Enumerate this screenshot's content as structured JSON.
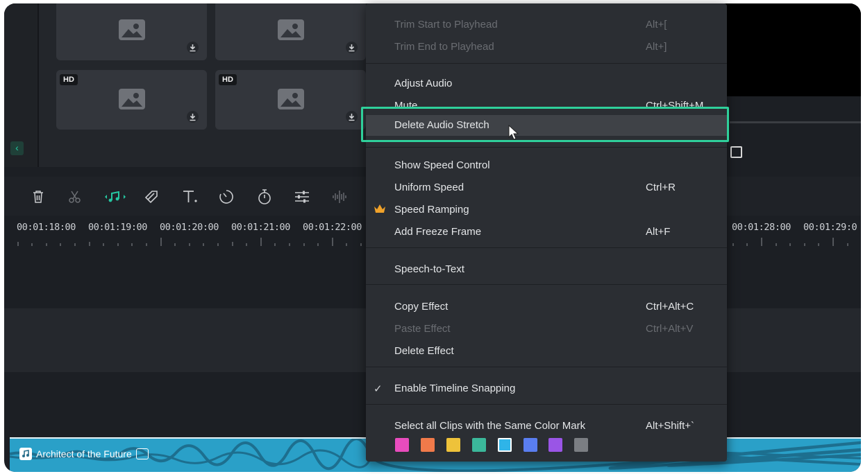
{
  "library": {
    "tiles": [
      {
        "badge": ""
      },
      {
        "badge": ""
      },
      {
        "badge": "HD"
      },
      {
        "badge": "HD"
      }
    ],
    "collapse_glyph": "‹"
  },
  "toolbar": {
    "tools": [
      "delete-icon",
      "scissors-icon",
      "audio-stretch-icon",
      "mask-icon",
      "text-icon",
      "speed-icon",
      "timer-icon",
      "adjust-icon",
      "audio-split-icon"
    ]
  },
  "ruler": {
    "left_labels": [
      "00:01:18:00",
      "00:01:19:00",
      "00:01:20:00",
      "00:01:21:00",
      "00:01:22:00"
    ],
    "right_labels": [
      "00:01:28:00",
      "00:01:29:0"
    ]
  },
  "audio_clip": {
    "title": "Architect of the Future"
  },
  "menu": {
    "items": [
      {
        "label": "Trim Start to Playhead",
        "shortcut": "Alt+[",
        "disabled": true
      },
      {
        "label": "Trim End to Playhead",
        "shortcut": "Alt+]",
        "disabled": true
      },
      {
        "label": "Adjust Audio",
        "shortcut": "",
        "disabled": false
      },
      {
        "label": "Mute",
        "shortcut": "Ctrl+Shift+M",
        "disabled": false
      },
      {
        "label": "Delete Audio Stretch",
        "shortcut": "",
        "disabled": false
      },
      {
        "label": "Show Speed Control",
        "shortcut": "",
        "disabled": false
      },
      {
        "label": "Uniform Speed",
        "shortcut": "Ctrl+R",
        "disabled": false
      },
      {
        "label": "Speed Ramping",
        "shortcut": "",
        "disabled": false
      },
      {
        "label": "Add Freeze Frame",
        "shortcut": "Alt+F",
        "disabled": false
      },
      {
        "label": "Speech-to-Text",
        "shortcut": "",
        "disabled": false
      },
      {
        "label": "Copy Effect",
        "shortcut": "Ctrl+Alt+C",
        "disabled": false
      },
      {
        "label": "Paste Effect",
        "shortcut": "Ctrl+Alt+V",
        "disabled": true
      },
      {
        "label": "Delete Effect",
        "shortcut": "",
        "disabled": false
      },
      {
        "label": "Enable Timeline Snapping",
        "shortcut": "",
        "disabled": false
      },
      {
        "label": "Select all Clips with the Same Color Mark",
        "shortcut": "Alt+Shift+`",
        "disabled": false
      }
    ],
    "snapping_check": "✓",
    "premium_icon": "crown-icon",
    "color_marks": [
      "#e84cbd",
      "#f07a4a",
      "#eec23a",
      "#3bb89a",
      "#2fb4e8",
      "#5a7ef0",
      "#9a55e6",
      "#7b7e83"
    ],
    "selected_color_index": 4
  },
  "colors": {
    "highlight": "#2fd09b",
    "accent": "#25c7a1",
    "audio_clip": "#2aa0c8"
  }
}
